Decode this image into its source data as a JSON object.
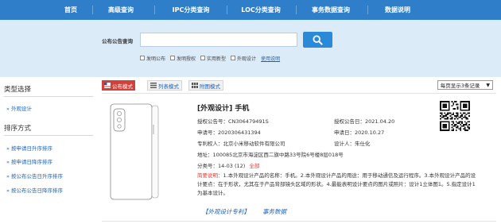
{
  "nav": {
    "items": [
      "首页",
      "高级查询",
      "IPC分类查询",
      "LOC分类查询",
      "事务数据查询",
      "数据说明"
    ]
  },
  "search": {
    "label": "公布公告查询",
    "value": "",
    "filters": [
      "发明公布",
      "发明授权",
      "实用新型",
      "外观设计"
    ],
    "help_link": "使用说明"
  },
  "sidebar": {
    "type_title": "类型选择",
    "type_items": [
      "» 外观设计"
    ],
    "sort_title": "排序方式",
    "sort_items": [
      "» 按申请日升序排序",
      "» 按申请日降序排序",
      "» 按公布公告日升序排序",
      "» 按公布公告日降序排序"
    ]
  },
  "toolbar": {
    "views": [
      "公布模式",
      "列表模式",
      "附图模式"
    ],
    "per_page": "每页显示3条记录"
  },
  "record": {
    "title": "[外观设计] 手机",
    "grant_no_label": "授权公告号：",
    "grant_no": "CN306479491S",
    "grant_date_label": "授权公告日：",
    "grant_date": "2021.04.20",
    "app_no_label": "申请号：",
    "app_no": "2020306431394",
    "app_date_label": "申请日：",
    "app_date": "2020.10.27",
    "patentee_label": "专利权人：",
    "patentee": "北京小米移动软件有限公司",
    "designer_label": "设计人：",
    "designer": "朱仕化",
    "address_label": "地址：",
    "address": "100085北京市海淀区西二旗中路33号院6号楼8层018号",
    "class_label": "分类号：",
    "class_no": "14-03 (12)",
    "class_all": "全部",
    "abstract_label": "简要说明：",
    "abstract": "1.本外观设计产品的名称：手机。2.本外观设计产品的用途：用于移动通信及运行程序。3.本外观设计产品的设计要点：在于形状，尤其在于产品背部镜头区域的形状。4.最能表明设计要点的图片或照片：设计1立体图1。5.指定设计1为基本设计。",
    "links": [
      "【外观设计专利】",
      "事务数据"
    ]
  },
  "colors": {
    "nav_bg": "#2f7ec9",
    "search_band_bg": "#dcebf8",
    "search_button": "#2b8ad8",
    "active_view": "#d2403a",
    "link": "#1a63b8"
  }
}
